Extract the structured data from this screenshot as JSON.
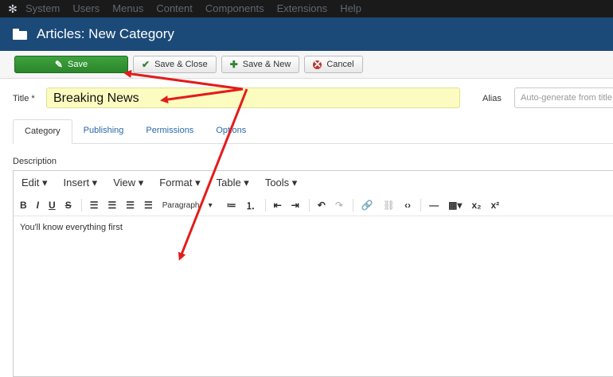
{
  "top_menu": {
    "items": [
      "System",
      "Users",
      "Menus",
      "Content",
      "Components",
      "Extensions",
      "Help"
    ]
  },
  "header": {
    "title": "Articles: New Category"
  },
  "toolbar": {
    "save": "Save",
    "save_close": "Save & Close",
    "save_new": "Save & New",
    "cancel": "Cancel"
  },
  "form": {
    "title_label": "Title *",
    "title_value": "Breaking News",
    "alias_label": "Alias",
    "alias_placeholder": "Auto-generate from title"
  },
  "tabs": [
    "Category",
    "Publishing",
    "Permissions",
    "Options"
  ],
  "description_label": "Description",
  "editor": {
    "menus": [
      "Edit ▾",
      "Insert ▾",
      "View ▾",
      "Format ▾",
      "Table ▾",
      "Tools ▾"
    ],
    "format_select": "Paragraph",
    "content": "You'll know everything first"
  },
  "colors": {
    "header_blue": "#1b4a78",
    "save_green": "#2f8f2f",
    "annotation_red": "#e31c1c",
    "title_highlight": "#fcfcc0"
  }
}
